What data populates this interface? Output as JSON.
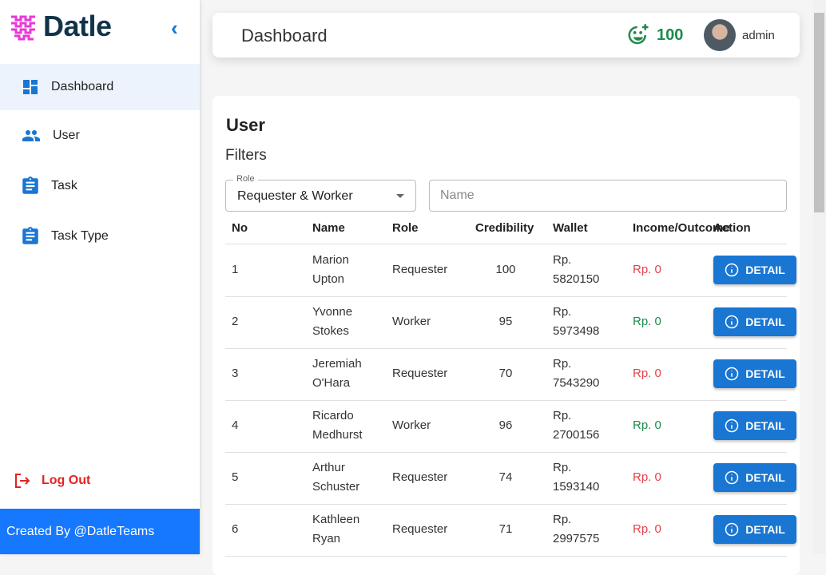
{
  "brand": {
    "name": "Datle",
    "logo_color": "#e83ad6"
  },
  "sidebar": {
    "items": [
      {
        "label": "Dashboard",
        "icon": "dashboard-icon"
      },
      {
        "label": "User",
        "icon": "people-icon"
      },
      {
        "label": "Task",
        "icon": "clipboard-icon"
      },
      {
        "label": "Task Type",
        "icon": "clipboard-icon"
      }
    ],
    "logout": "Log Out",
    "footer": "Created By @DatleTeams"
  },
  "header": {
    "title": "Dashboard",
    "score": "100",
    "user": "admin"
  },
  "main": {
    "title": "User",
    "filters_label": "Filters",
    "role_label": "Role",
    "role_value": "Requester & Worker",
    "name_placeholder": "Name",
    "columns": [
      "No",
      "Name",
      "Role",
      "Credibility",
      "Wallet",
      "Income/Outcome",
      "Action"
    ],
    "rows": [
      {
        "no": "1",
        "name1": "Marion",
        "name2": "Upton",
        "role": "Requester",
        "cred": "100",
        "w1": "Rp.",
        "w2": "5820150",
        "io": "Rp. 0",
        "io_color": "#e5404a",
        "action": "DETAIL"
      },
      {
        "no": "2",
        "name1": "Yvonne",
        "name2": "Stokes",
        "role": "Worker",
        "cred": "95",
        "w1": "Rp.",
        "w2": "5973498",
        "io": "Rp. 0",
        "io_color": "#1e8a4c",
        "action": "DETAIL"
      },
      {
        "no": "3",
        "name1": "Jeremiah",
        "name2": "O'Hara",
        "role": "Requester",
        "cred": "70",
        "w1": "Rp.",
        "w2": "7543290",
        "io": "Rp. 0",
        "io_color": "#e5404a",
        "action": "DETAIL"
      },
      {
        "no": "4",
        "name1": "Ricardo",
        "name2": "Medhurst",
        "role": "Worker",
        "cred": "96",
        "w1": "Rp.",
        "w2": "2700156",
        "io": "Rp. 0",
        "io_color": "#1e8a4c",
        "action": "DETAIL"
      },
      {
        "no": "5",
        "name1": "Arthur",
        "name2": "Schuster",
        "role": "Requester",
        "cred": "74",
        "w1": "Rp.",
        "w2": "1593140",
        "io": "Rp. 0",
        "io_color": "#e5404a",
        "action": "DETAIL"
      },
      {
        "no": "6",
        "name1": "Kathleen",
        "name2": "Ryan",
        "role": "Requester",
        "cred": "71",
        "w1": "Rp.",
        "w2": "2997575",
        "io": "Rp. 0",
        "io_color": "#e5404a",
        "action": "DETAIL"
      }
    ]
  }
}
